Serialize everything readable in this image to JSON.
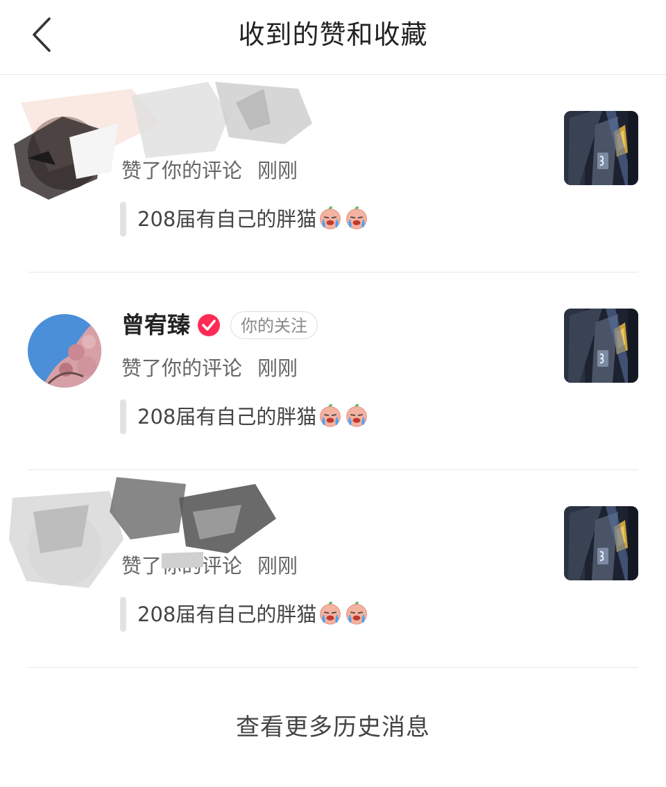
{
  "header": {
    "title": "收到的赞和收藏",
    "back_icon": "chevron-left-icon"
  },
  "notifications": [
    {
      "user_name": "",
      "redacted": true,
      "action": "赞了你的评论",
      "time": "刚刚",
      "quote": "208届有自己的胖猫",
      "emojis": [
        "crying-face-icon",
        "crying-face-icon"
      ]
    },
    {
      "user_name": "曾宥臻",
      "verified": true,
      "follow_tag": "你的关注",
      "action": "赞了你的评论",
      "time": "刚刚",
      "quote": "208届有自己的胖猫",
      "emojis": [
        "crying-face-icon",
        "crying-face-icon"
      ]
    },
    {
      "user_name": "",
      "redacted": true,
      "action": "赞了你的评论",
      "time": "刚刚",
      "quote": "208届有自己的胖猫",
      "emojis": [
        "crying-face-icon",
        "crying-face-icon"
      ]
    }
  ],
  "footer": {
    "more_label": "查看更多历史消息"
  },
  "colors": {
    "verified_badge": "#fe2c55",
    "divider": "#e8e8e8"
  }
}
